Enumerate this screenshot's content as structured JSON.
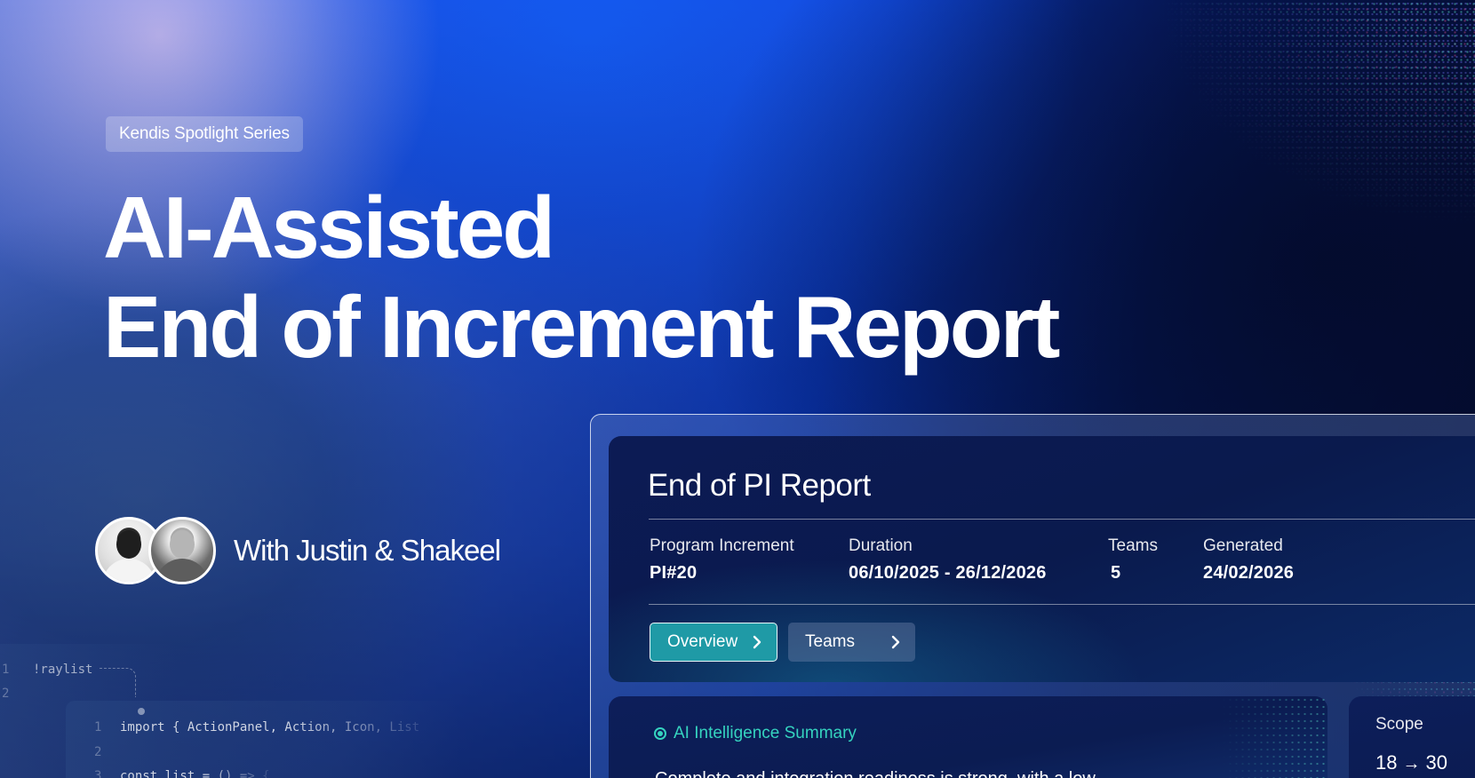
{
  "hero": {
    "badge": "Kendis Spotlight Series",
    "title_line1": "AI-Assisted",
    "title_line2": "End of Increment Report",
    "hosts": "With Justin & Shakeel"
  },
  "code_snippet": {
    "line1_num": "1",
    "line1": "!raylist",
    "line2_num": "2",
    "inner_line1_num": "1",
    "inner_line1": "import { ActionPanel, Action, Icon, List",
    "inner_line2_num": "2",
    "inner_line3_num": "3",
    "inner_line3": "const list = () => {"
  },
  "report": {
    "title": "End of PI Report",
    "meta": [
      {
        "label": "Program Increment",
        "value": "PI#20"
      },
      {
        "label": "Duration",
        "value": "06/10/2025 - 26/12/2026"
      },
      {
        "label": "Teams",
        "value": "5"
      },
      {
        "label": "Generated",
        "value": "24/02/2026"
      }
    ],
    "tabs": [
      {
        "label": "Overview",
        "active": true
      },
      {
        "label": "Teams",
        "active": false
      }
    ]
  },
  "ai_summary": {
    "label": "AI Intelligence Summary",
    "text": "Complete and integration readiness is strong, with a low"
  },
  "scope": {
    "label": "Scope",
    "from": "18",
    "arrow": "→",
    "to": "30"
  },
  "colors": {
    "accent_teal": "#35d3bf",
    "tab_active": "#1f9aa6",
    "brand_blue": "#0b3ed0",
    "panel_navy": "#0c1b55"
  },
  "icons": {
    "tab_chevron": "chevron-right-icon",
    "ai_status": "radio-dot-icon"
  }
}
